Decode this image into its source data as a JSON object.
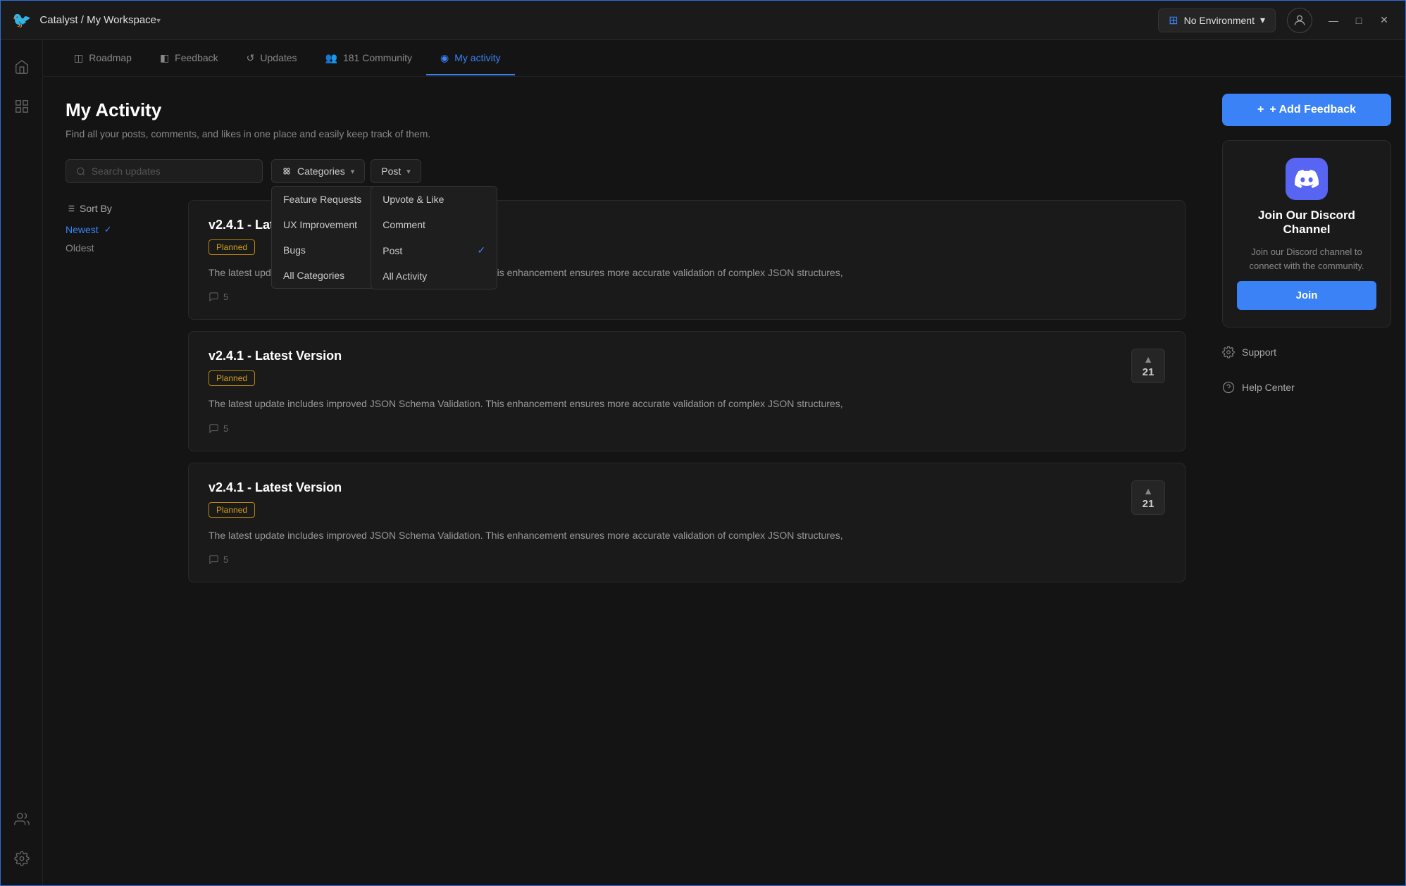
{
  "titlebar": {
    "logo": "🐦",
    "title": "Catalyst / My Workspace",
    "chevron": "▾",
    "env_icon": "⊞",
    "env_label": "No Environment",
    "env_chevron": "▾",
    "user_icon": "👤",
    "btn_minimize": "—",
    "btn_maximize": "□",
    "btn_close": "✕"
  },
  "sidebar": {
    "top_items": [
      {
        "icon": "⌂",
        "name": "home",
        "active": false
      },
      {
        "icon": "⊞",
        "name": "dashboard",
        "active": false
      }
    ],
    "bottom_items": [
      {
        "icon": "👥",
        "name": "team",
        "active": false
      },
      {
        "icon": "⚙",
        "name": "settings",
        "active": false
      }
    ]
  },
  "tabs": [
    {
      "icon": "◫",
      "label": "Roadmap",
      "active": false
    },
    {
      "icon": "◧",
      "label": "Feedback",
      "active": false
    },
    {
      "icon": "↺",
      "label": "Updates",
      "active": false
    },
    {
      "icon": "👥",
      "label": "Community",
      "active": false,
      "count": "181"
    },
    {
      "icon": "◉",
      "label": "My activity",
      "active": true
    }
  ],
  "page": {
    "title": "My Activity",
    "subtitle": "Find all your posts, comments, and likes in one place and easily keep track of them."
  },
  "search": {
    "placeholder": "Search updates"
  },
  "categories_dropdown": {
    "label": "Categories",
    "icon": "⊞",
    "items": [
      {
        "label": "Feature Requests",
        "selected": false
      },
      {
        "label": "UX Improvement",
        "selected": false
      },
      {
        "label": "Bugs",
        "selected": false
      },
      {
        "label": "All Categories",
        "selected": false
      }
    ]
  },
  "post_dropdown": {
    "label": "Post",
    "items": [
      {
        "label": "Upvote & Like",
        "selected": false
      },
      {
        "label": "Comment",
        "selected": false
      },
      {
        "label": "Post",
        "selected": true
      },
      {
        "label": "All Activity",
        "selected": false
      }
    ]
  },
  "sort": {
    "label": "Sort By",
    "options": [
      {
        "label": "Newest",
        "active": true
      },
      {
        "label": "Oldest",
        "active": false
      }
    ]
  },
  "posts": [
    {
      "title": "v2.4.1 - Latest Version",
      "badge": "Planned",
      "body": "The latest update includes improved JSON Schema Validation. This enhancement ensures more accurate validation of complex JSON structures,",
      "comments": "5",
      "has_vote": false,
      "vote_count": ""
    },
    {
      "title": "v2.4.1 - Latest Version",
      "badge": "Planned",
      "body": "The latest update includes improved JSON Schema Validation. This enhancement ensures more accurate validation of complex JSON structures,",
      "comments": "5",
      "has_vote": true,
      "vote_count": "21"
    },
    {
      "title": "v2.4.1 - Latest Version",
      "badge": "Planned",
      "body": "The latest update includes improved JSON Schema Validation. This enhancement ensures more accurate validation of complex JSON structures,",
      "comments": "5",
      "has_vote": true,
      "vote_count": "21"
    }
  ],
  "sidebar_right": {
    "add_feedback_label": "+ Add Feedback",
    "discord": {
      "title": "Join Our Discord Channel",
      "description": "Join our Discord channel to connect with the community.",
      "join_label": "Join"
    },
    "support_label": "Support",
    "help_label": "Help Center"
  }
}
